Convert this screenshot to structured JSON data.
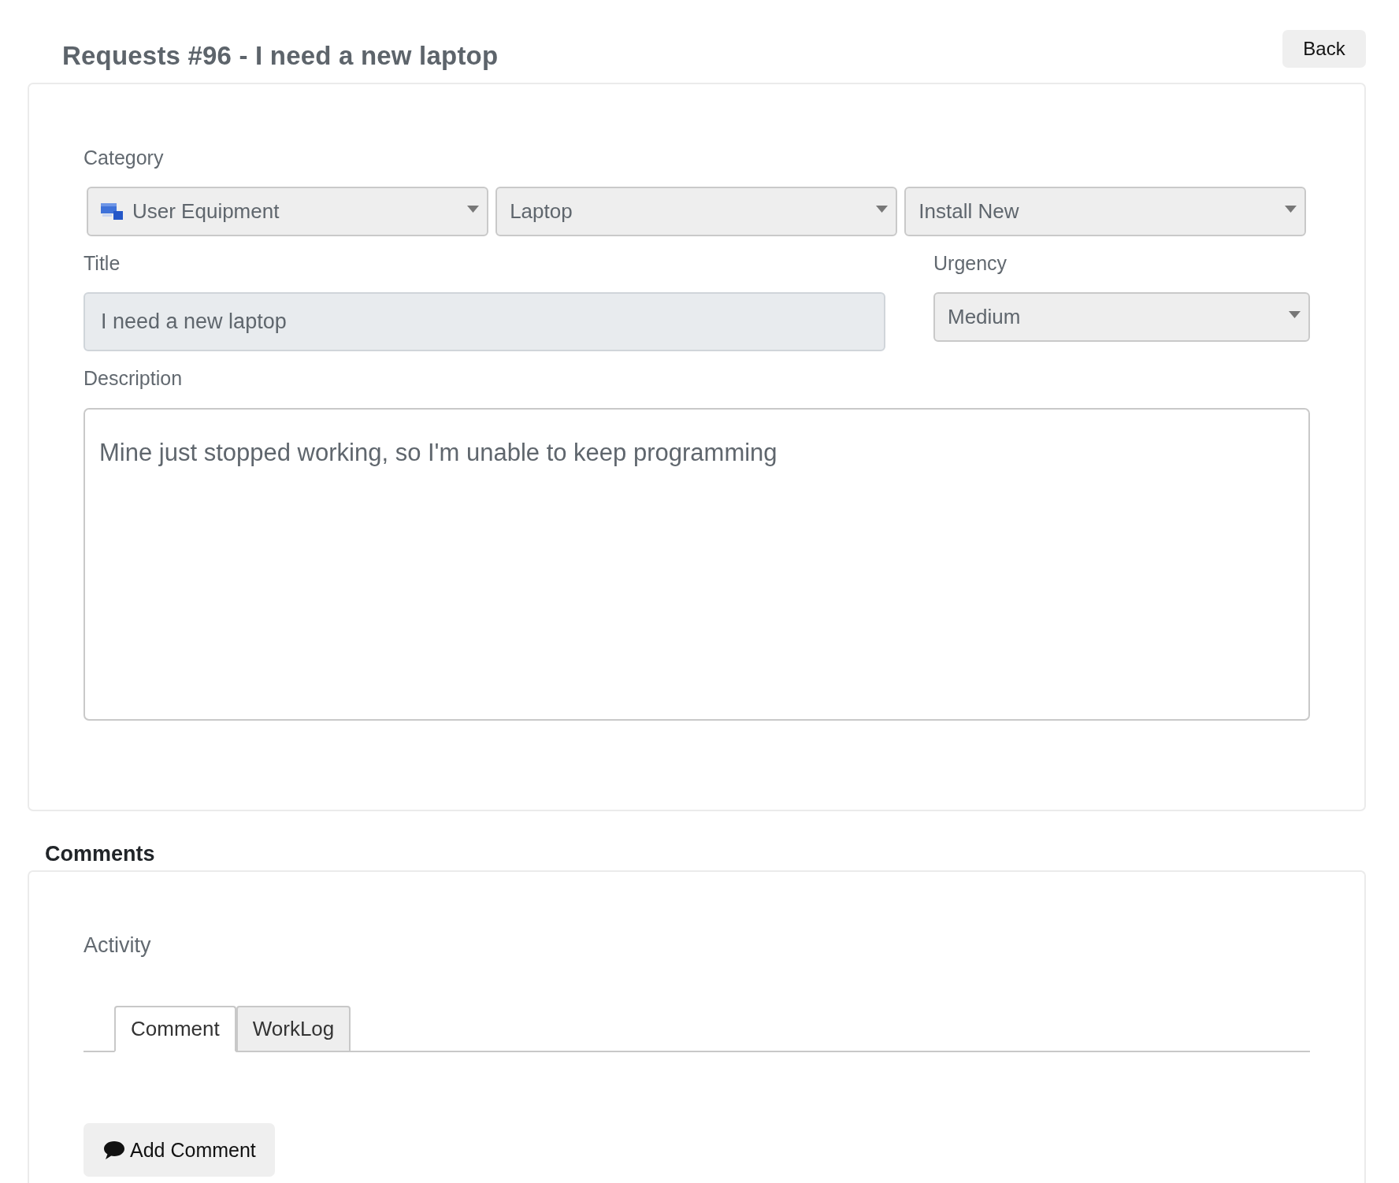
{
  "header": {
    "title": "Requests #96 - I need a new laptop",
    "back_button": "Back"
  },
  "request": {
    "category": {
      "label": "Category",
      "selects": [
        {
          "kind": "icon",
          "value": "User Equipment"
        },
        {
          "kind": "plain",
          "value": "Laptop"
        },
        {
          "kind": "plain",
          "value": "Install New"
        }
      ]
    },
    "title": {
      "label": "Title",
      "value": "I need a new laptop",
      "disabled": true
    },
    "urgency": {
      "label": "Urgency",
      "value": "Medium"
    },
    "description": {
      "label": "Description",
      "value": "Mine just stopped working, so I'm unable to keep programming"
    }
  },
  "comments": {
    "heading": "Comments",
    "activity_label": "Activity",
    "tabs": [
      {
        "label": "Comment",
        "selected": true
      },
      {
        "label": "WorkLog",
        "selected": false
      }
    ],
    "add_button": "Add Comment"
  }
}
